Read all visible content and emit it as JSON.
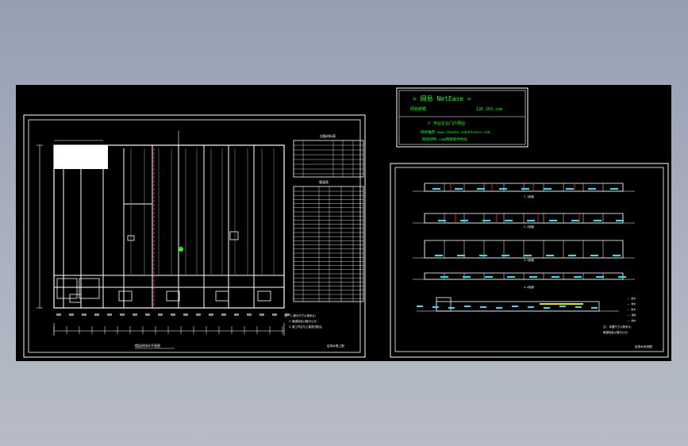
{
  "viewer": {
    "canvas_color": "#000000",
    "background_color": "#a3abbb"
  },
  "stamp": {
    "title": "=  网易 NetEase  =",
    "line1_left": "网易邮箱",
    "line1_right": "126.163.com",
    "line2": "※ 专业企业门户网站",
    "line3": "网易推荐 www.ibooks.ndnetease.com",
    "line4": "网易邮件.com网易邮件地址"
  },
  "sheet_left": {
    "table_title_top": "设备材料表",
    "table_title_middle": "管道表",
    "notes": [
      "注: 1.图中尺寸以毫米计;",
      "2.管道标高以管中心计;",
      "3.施工时应与土建密切配合。"
    ],
    "caption": "楼层给排水平面图",
    "title_block": "给排水施工图"
  },
  "sheet_right": {
    "section_labels": [
      "1-1剖面",
      "2-2剖面",
      "3-3剖面",
      "4-4剖面"
    ],
    "legend_items": [
      "—— 给水",
      "—— 排水",
      "—— 雨水",
      "—— 消防",
      "—— 热水"
    ],
    "notes": [
      "注: 本图尺寸以毫米计。",
      "管道标高以管中心计。"
    ],
    "title_block": "给排水系统图"
  },
  "colors": {
    "line": "#ffffff",
    "accent_red": "#ff2a2a",
    "accent_cyan": "#1ee6ff",
    "accent_green": "#19ff19",
    "accent_yellow": "#e6e61a"
  }
}
